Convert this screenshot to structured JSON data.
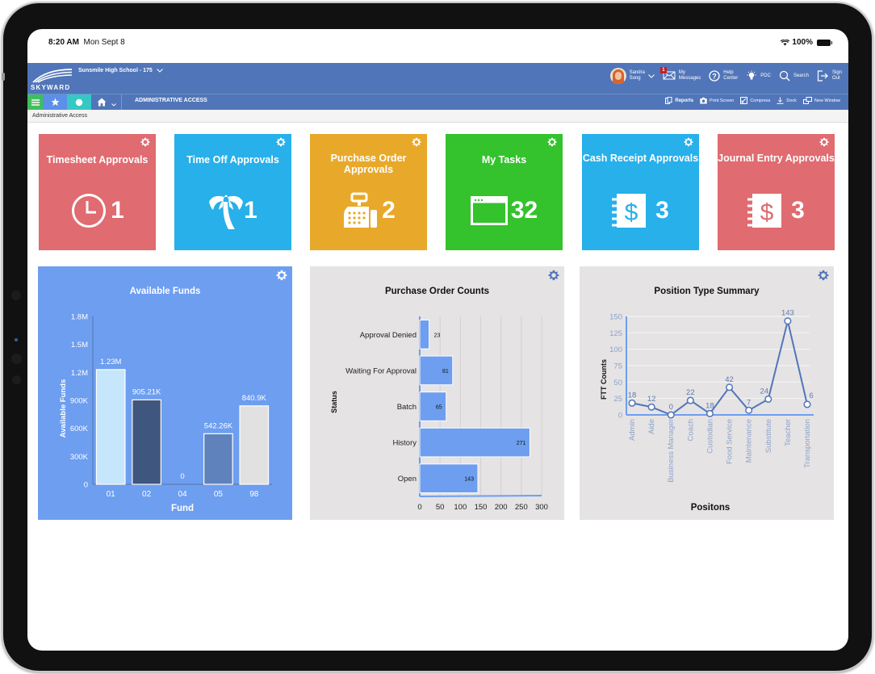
{
  "status_bar": {
    "time": "8:20 AM",
    "date": "Mon Sept 8",
    "battery": "100%"
  },
  "app": {
    "logo_text": "SKYWARD",
    "school": "Sunsmile High School - 175",
    "user": {
      "first": "Sandra",
      "last": "Song"
    },
    "nav": [
      {
        "icon": "envelope-icon",
        "line1": "My",
        "line2": "Messages",
        "badge": "1"
      },
      {
        "icon": "help-icon",
        "line1": "Help",
        "line2": "Center"
      },
      {
        "icon": "lightbulb-icon",
        "line1": "PDC",
        "line2": ""
      },
      {
        "icon": "search-icon",
        "line1": "Search",
        "line2": ""
      },
      {
        "icon": "sign-out-icon",
        "line1": "Sign",
        "line2": "Out"
      }
    ]
  },
  "toolbar": {
    "section_title": "ADMINISTRATIVE ACCESS",
    "tools": [
      {
        "icon": "reports-icon",
        "label": "Reports"
      },
      {
        "icon": "camera-icon",
        "label": "Print Screen"
      },
      {
        "icon": "compress-icon",
        "label": "Compress"
      },
      {
        "icon": "dock-icon",
        "label": "Dock"
      },
      {
        "icon": "new-window-icon",
        "label": "New Window"
      }
    ]
  },
  "breadcrumb": "Administrative Access",
  "tiles": [
    {
      "title": "Timesheet Approvals",
      "count": "1",
      "icon": "clock-icon",
      "color": "#e06b70"
    },
    {
      "title": "Time Off Approvals",
      "count": "1",
      "icon": "palm-tree-icon",
      "color": "#27b0ea"
    },
    {
      "title": "Purchase Order Approvals",
      "count": "2",
      "icon": "cash-register-icon",
      "color": "#e8a92a"
    },
    {
      "title": "My Tasks",
      "count": "32",
      "icon": "window-icon",
      "color": "#34c22d"
    },
    {
      "title": "Cash Receipt Approvals",
      "count": "3",
      "icon": "dollar-notebook-icon",
      "color": "#27b0ea"
    },
    {
      "title": "Journal Entry Approvals",
      "count": "3",
      "icon": "dollar-notebook-icon",
      "color": "#e06b70"
    }
  ],
  "chart_data": [
    {
      "type": "bar",
      "title": "Available Funds",
      "xlabel": "Fund",
      "ylabel": "Available Funds",
      "categories": [
        "01",
        "02",
        "04",
        "05",
        "98"
      ],
      "values": [
        1230000,
        905210,
        0,
        542260,
        840900
      ],
      "data_labels": [
        "1.23M",
        "905.21K",
        "0",
        "542.26K",
        "840.9K"
      ],
      "bar_colors": [
        "#c6e6fb",
        "#3f567e",
        "#6d9ef0",
        "#5f82bd",
        "#e1e1e1"
      ],
      "yticks": [
        "0",
        "300K",
        "600K",
        "900K",
        "1.2M",
        "1.5M",
        "1.8M"
      ],
      "ylim": [
        0,
        1800000
      ],
      "background": "#6d9ef0"
    },
    {
      "type": "bar",
      "orientation": "horizontal",
      "title": "Purchase Order Counts",
      "ylabel": "Status",
      "xlabel": "",
      "categories": [
        "Approval Denied",
        "Waiting For Approval",
        "Batch",
        "History",
        "Open"
      ],
      "values": [
        23,
        81,
        65,
        271,
        143
      ],
      "xticks": [
        "0",
        "50",
        "100",
        "150",
        "200",
        "250",
        "300"
      ],
      "xlim": [
        0,
        300
      ],
      "bar_color": "#6d9ef0",
      "background": "#e5e3e4"
    },
    {
      "type": "line",
      "title": "Position Type Summary",
      "xlabel": "Positons",
      "ylabel": "FTT Counts",
      "categories": [
        "Admin",
        "Aide",
        "Business Manager",
        "Coach",
        "Custodian",
        "Food Service",
        "Maintenance",
        "Substitute",
        "Teacher",
        "Transportation"
      ],
      "values": [
        18,
        12,
        0,
        22,
        2,
        42,
        7,
        24,
        143,
        16
      ],
      "data_labels": [
        "18",
        "12",
        "0",
        "22",
        "18",
        "42",
        "7",
        "24",
        "143",
        "6"
      ],
      "yticks": [
        "0",
        "25",
        "50",
        "75",
        "100",
        "125",
        "150"
      ],
      "ylim": [
        0,
        150
      ],
      "grid": true,
      "line_color": "#5175b9",
      "background": "#e5e3e4"
    }
  ]
}
